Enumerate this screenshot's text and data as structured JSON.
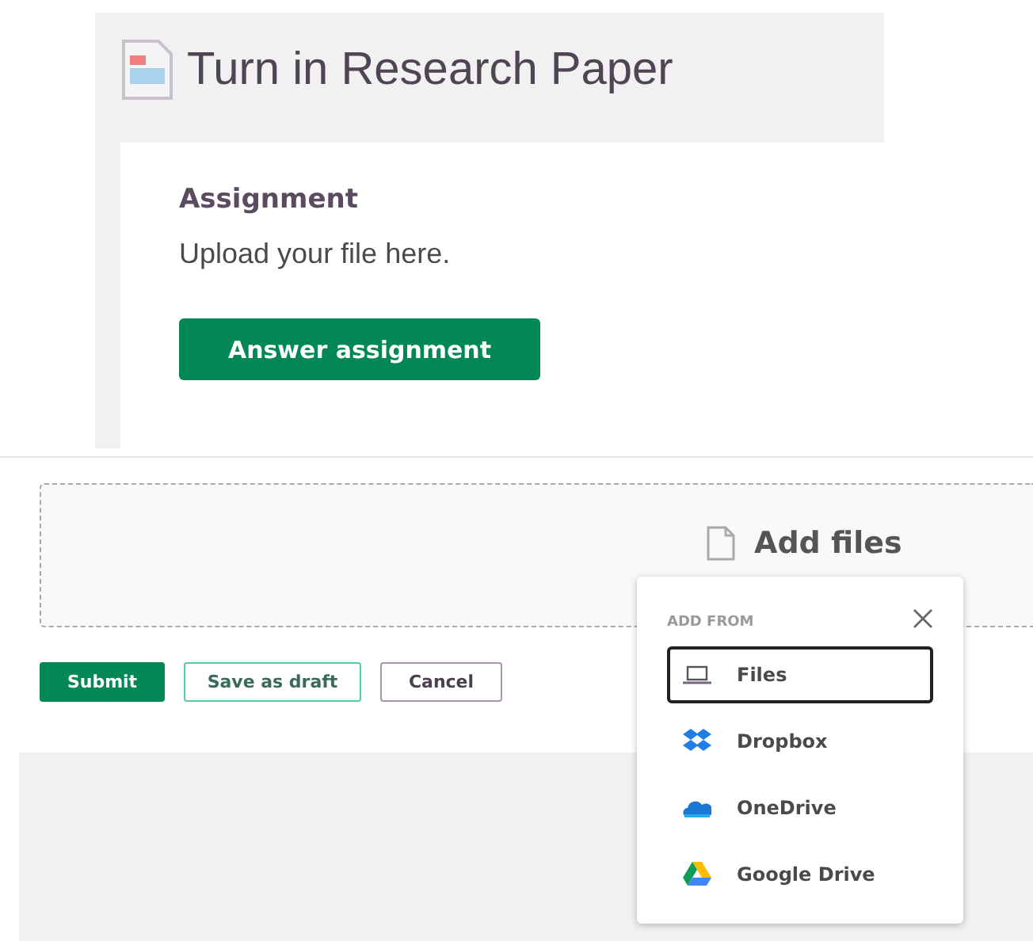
{
  "header": {
    "title": "Turn in Research Paper"
  },
  "card": {
    "heading": "Assignment",
    "text": "Upload your file here.",
    "button": "Answer assignment"
  },
  "dropzone": {
    "label": "Add files"
  },
  "actions": [
    {
      "label": "Submit",
      "kind": "primary"
    },
    {
      "label": "Save as draft",
      "kind": "secondary"
    },
    {
      "label": "Cancel",
      "kind": "cancel"
    }
  ],
  "popup": {
    "heading": "ADD FROM",
    "items": [
      {
        "label": "Files",
        "kind": "computer",
        "selected": true
      },
      {
        "label": "Dropbox",
        "kind": "dropbox",
        "selected": false
      },
      {
        "label": "OneDrive",
        "kind": "onedrive",
        "selected": false
      },
      {
        "label": "Google Drive",
        "kind": "gdrive",
        "selected": false
      }
    ]
  }
}
